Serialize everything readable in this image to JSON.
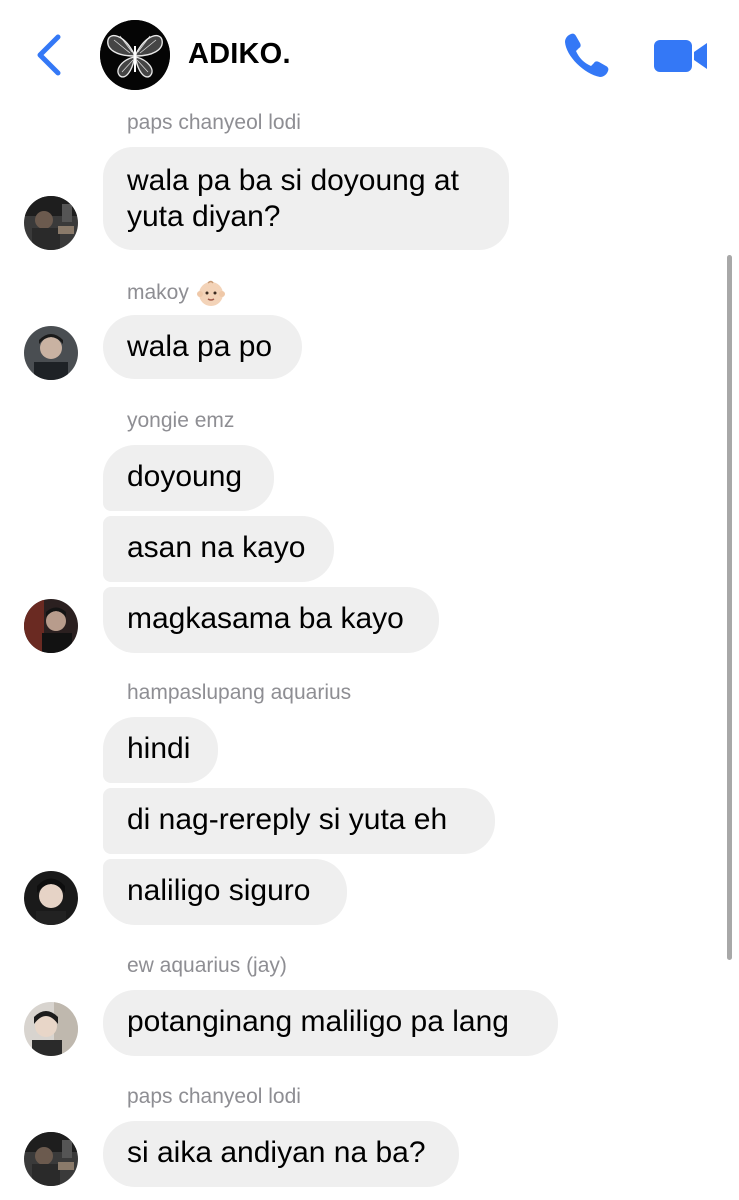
{
  "header": {
    "title": "ADIKO.",
    "back_icon": "chevron-left-icon",
    "call_icon": "phone-icon",
    "video_icon": "video-camera-icon",
    "accent_color": "#3478f6"
  },
  "messages": [
    {
      "sender": "paps chanyeol lodi",
      "texts": [
        "wala pa ba si doyoung at",
        "yuta diyan?"
      ]
    },
    {
      "sender": "makoy",
      "sender_emoji": "baby-face-emoji",
      "texts": [
        "wala pa po"
      ]
    },
    {
      "sender": "yongie emz",
      "texts": [
        "doyoung",
        "asan na kayo",
        "magkasama ba kayo"
      ]
    },
    {
      "sender": "hampaslupang aquarius",
      "texts": [
        "hindi",
        "di nag-rereply si yuta eh",
        "naliligo siguro"
      ]
    },
    {
      "sender": "ew aquarius (jay)",
      "texts": [
        "potanginang maliligo pa lang"
      ]
    },
    {
      "sender": "paps chanyeol lodi",
      "texts": [
        "si aika andiyan na ba?"
      ]
    }
  ],
  "colors": {
    "bubble_bg": "#efefef",
    "sender_text": "#8e8e93"
  }
}
